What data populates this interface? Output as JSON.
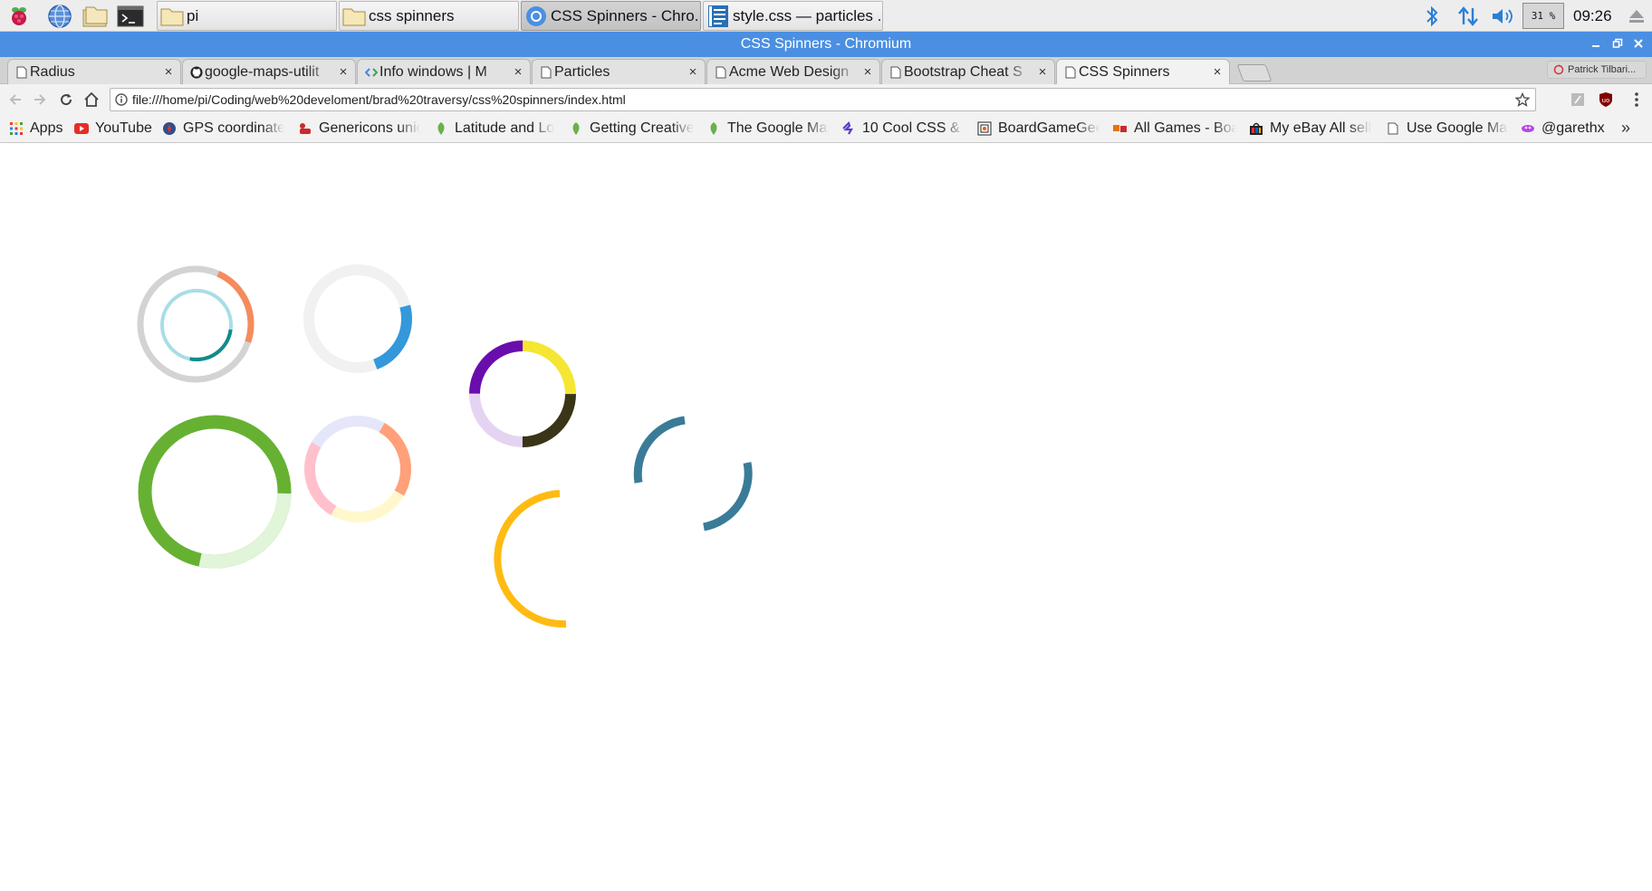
{
  "taskbar": {
    "launchers": [
      "raspberry-menu-icon",
      "web-browser-icon",
      "file-manager-icon",
      "terminal-icon"
    ],
    "tasks": [
      {
        "label": "pi",
        "icon": "folder-icon",
        "active": false
      },
      {
        "label": "css spinners",
        "icon": "folder-icon",
        "active": false
      },
      {
        "label": "CSS Spinners - Chro...",
        "icon": "chromium-icon",
        "active": true
      },
      {
        "label": "style.css — particles ...",
        "icon": "text-editor-icon",
        "active": false
      }
    ],
    "cpu": "31 %",
    "clock": "09:26"
  },
  "window": {
    "title": "CSS Spinners - Chromium"
  },
  "tabs": [
    {
      "label": "Radius",
      "icon": "page-icon",
      "active": false
    },
    {
      "label": "google-maps-utilit",
      "icon": "github-icon",
      "active": false
    },
    {
      "label": "Info windows  |  M",
      "icon": "google-dev-icon",
      "active": false
    },
    {
      "label": "Particles",
      "icon": "page-icon",
      "active": false
    },
    {
      "label": "Acme Web Design",
      "icon": "page-icon",
      "active": false
    },
    {
      "label": "Bootstrap Cheat S",
      "icon": "page-icon",
      "active": false
    },
    {
      "label": "CSS Spinners",
      "icon": "page-icon",
      "active": true
    }
  ],
  "tab_close": "×",
  "profile": "Patrick Tilbari...",
  "toolbar": {
    "url": "file:///home/pi/Coding/web%20develoment/brad%20traversy/css%20spinners/index.html"
  },
  "bookmarks": {
    "items": [
      {
        "label": "Apps",
        "icon": "apps-grid-icon"
      },
      {
        "label": "YouTube",
        "icon": "youtube-icon"
      },
      {
        "label": "GPS coordinate",
        "icon": "gps-icon"
      },
      {
        "label": "Genericons unic",
        "icon": "genericons-icon"
      },
      {
        "label": "Latitude and Lo",
        "icon": "leaf-icon"
      },
      {
        "label": "Getting Creative",
        "icon": "leaf-icon"
      },
      {
        "label": "The Google Map",
        "icon": "leaf-icon"
      },
      {
        "label": "10 Cool CSS & J",
        "icon": "css-icon"
      },
      {
        "label": "BoardGameGee",
        "icon": "boardgamegeek-icon"
      },
      {
        "label": "All Games - Boa",
        "icon": "games-icon"
      },
      {
        "label": "My eBay All sell",
        "icon": "ebay-icon"
      },
      {
        "label": "Use Google Map",
        "icon": "page-icon"
      },
      {
        "label": "@garethx",
        "icon": "glitch-icon"
      }
    ],
    "more": "»"
  },
  "spinners": {
    "colors": {
      "grey_ring": "#d3d3d3",
      "orange": "#f58b5c",
      "light_blue": "#a8dde6",
      "teal": "#138a8a",
      "pale_grey": "#f1f1f1",
      "blue": "#3498db",
      "purple": "#6a0dad",
      "yellow": "#f5e633",
      "dark_olive": "#3a3418",
      "lavender": "#e4d4f2",
      "green": "#66b132",
      "pale_green": "#e1f5d9",
      "periwinkle": "#e6e6fa",
      "salmon": "#ffa07a",
      "cream": "#fff8cd",
      "pink": "#ffc0cb",
      "amber": "#ffbb12",
      "steel_blue": "#3a7b98"
    }
  }
}
